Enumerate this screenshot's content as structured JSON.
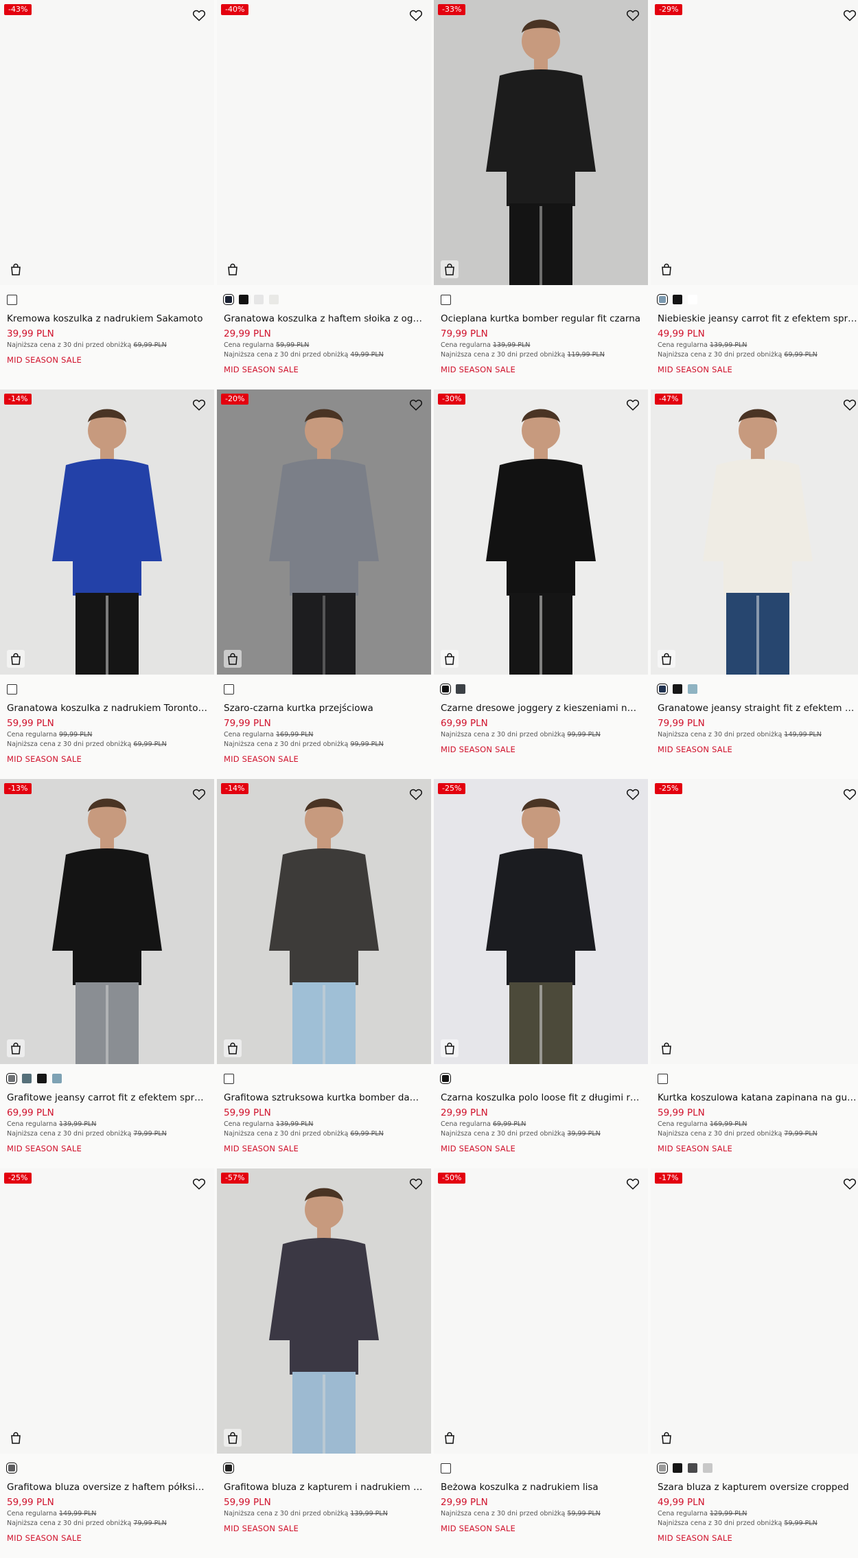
{
  "products": [
    {
      "badge": "-43%",
      "photo": false,
      "title": "Kremowa koszulka z nadrukiem Sakamoto",
      "price": "39,99 PLN",
      "regular": null,
      "lowest_label": "Najniższa cena z 30 dni przed obniżką",
      "lowest": "69,99 PLN",
      "sale": "MID SEASON SALE",
      "swatches": [
        {
          "c": "#ffffff",
          "type": "empty"
        }
      ],
      "bg": "#f7f7f6",
      "figure": null
    },
    {
      "badge": "-40%",
      "photo": false,
      "title": "Granatowa koszulka z haftem słoika z ogórkiem",
      "price": "29,99 PLN",
      "regular_label": "Cena regularna",
      "regular": "59,99 PLN",
      "lowest_label": "Najniższa cena z 30 dni przed obniżką",
      "lowest": "49,99 PLN",
      "sale": "MID SEASON SALE",
      "swatches": [
        {
          "c": "#1b2233",
          "type": "sel"
        },
        {
          "c": "#111111"
        },
        {
          "c": "#e6e6e6"
        },
        {
          "c": "#e9e9e6"
        }
      ],
      "bg": "#f7f7f6",
      "figure": null
    },
    {
      "badge": "-33%",
      "photo": true,
      "title": "Ocieplana kurtka bomber regular fit czarna",
      "price": "79,99 PLN",
      "regular_label": "Cena regularna",
      "regular": "139,99 PLN",
      "lowest_label": "Najniższa cena z 30 dni przed obniżką",
      "lowest": "119,99 PLN",
      "sale": "MID SEASON SALE",
      "swatches": [
        {
          "c": "#ffffff",
          "type": "empty"
        }
      ],
      "bg": "#c9c9c8",
      "figure": {
        "top": "#1c1c1c",
        "bottom": "#141414"
      }
    },
    {
      "badge": "-29%",
      "photo": false,
      "title": "Niebieskie jeansy carrot fit z efektem sprania",
      "price": "49,99 PLN",
      "regular_label": "Cena regularna",
      "regular": "139,99 PLN",
      "lowest_label": "Najniższa cena z 30 dni przed obniżką",
      "lowest": "69,99 PLN",
      "sale": "MID SEASON SALE",
      "swatches": [
        {
          "c": "#7c9ab0",
          "type": "sel"
        },
        {
          "c": "#141414"
        },
        {
          "c": "#ffffff"
        }
      ],
      "bg": "#f7f7f6",
      "figure": null
    },
    {
      "badge": "-14%",
      "photo": true,
      "title": "Granatowa koszulka z nadrukiem Toronto Maple Leafs",
      "price": "59,99 PLN",
      "regular_label": "Cena regularna",
      "regular": "99,99 PLN",
      "lowest_label": "Najniższa cena z 30 dni przed obniżką",
      "lowest": "69,99 PLN",
      "sale": "MID SEASON SALE",
      "swatches": [
        {
          "c": "#ffffff",
          "type": "empty"
        }
      ],
      "bg": "#e4e4e3",
      "figure": {
        "top": "#2341a8",
        "bottom": "#151515"
      }
    },
    {
      "badge": "-20%",
      "photo": true,
      "title": "Szaro-czarna kurtka przejściowa",
      "price": "79,99 PLN",
      "regular_label": "Cena regularna",
      "regular": "169,99 PLN",
      "lowest_label": "Najniższa cena z 30 dni przed obniżką",
      "lowest": "99,99 PLN",
      "sale": "MID SEASON SALE",
      "swatches": [
        {
          "c": "#ffffff",
          "type": "empty"
        }
      ],
      "bg": "#8d8d8d",
      "figure": {
        "top": "#7b7f88",
        "bottom": "#1d1d1f"
      }
    },
    {
      "badge": "-30%",
      "photo": true,
      "title": "Czarne dresowe joggery z kieszeniami na zamek",
      "price": "69,99 PLN",
      "regular": null,
      "lowest_label": "Najniższa cena z 30 dni przed obniżką",
      "lowest": "99,99 PLN",
      "sale": "MID SEASON SALE",
      "swatches": [
        {
          "c": "#111111",
          "type": "sel"
        },
        {
          "c": "#3c4146"
        }
      ],
      "bg": "#ededec",
      "figure": {
        "top": "#121212",
        "bottom": "#151515"
      }
    },
    {
      "badge": "-47%",
      "photo": true,
      "title": "Granatowe jeansy straight fit z efektem sprania",
      "price": "79,99 PLN",
      "regular": null,
      "lowest_label": "Najniższa cena z 30 dni przed obniżką",
      "lowest": "149,99 PLN",
      "sale": "MID SEASON SALE",
      "swatches": [
        {
          "c": "#20324f",
          "type": "sel"
        },
        {
          "c": "#171717"
        },
        {
          "c": "#8fb3c2"
        }
      ],
      "bg": "#ececeb",
      "figure": {
        "top": "#efece4",
        "bottom": "#27466f"
      }
    },
    {
      "badge": "-13%",
      "photo": true,
      "title": "Grafitowe jeansy carrot fit z efektem sprania",
      "price": "69,99 PLN",
      "regular_label": "Cena regularna",
      "regular": "139,99 PLN",
      "lowest_label": "Najniższa cena z 30 dni przed obniżką",
      "lowest": "79,99 PLN",
      "sale": "MID SEASON SALE",
      "swatches": [
        {
          "c": "#6f7275",
          "type": "sel"
        },
        {
          "c": "#56707a"
        },
        {
          "c": "#161616"
        },
        {
          "c": "#7ea2b4"
        }
      ],
      "bg": "#d8d8d7",
      "figure": {
        "top": "#141414",
        "bottom": "#8a8e93"
      }
    },
    {
      "badge": "-14%",
      "photo": true,
      "title": "Grafitowa sztruksowa kurtka bomber dad fit",
      "price": "59,99 PLN",
      "regular_label": "Cena regularna",
      "regular": "139,99 PLN",
      "lowest_label": "Najniższa cena z 30 dni przed obniżką",
      "lowest": "69,99 PLN",
      "sale": "MID SEASON SALE",
      "swatches": [
        {
          "c": "#ffffff",
          "type": "empty"
        }
      ],
      "bg": "#d6d6d4",
      "figure": {
        "top": "#3d3b39",
        "bottom": "#9fbfd6"
      }
    },
    {
      "badge": "-25%",
      "photo": true,
      "title": "Czarna koszulka polo loose fit z długimi rękawami",
      "price": "29,99 PLN",
      "regular_label": "Cena regularna",
      "regular": "69,99 PLN",
      "lowest_label": "Najniższa cena z 30 dni przed obniżką",
      "lowest": "39,99 PLN",
      "sale": "MID SEASON SALE",
      "swatches": [
        {
          "c": "#141414",
          "type": "sel"
        }
      ],
      "bg": "#e6e6ea",
      "figure": {
        "top": "#1b1c20",
        "bottom": "#4c4a3a"
      }
    },
    {
      "badge": "-25%",
      "photo": false,
      "title": "Kurtka koszulowa katana zapinana na guziki",
      "price": "59,99 PLN",
      "regular_label": "Cena regularna",
      "regular": "169,99 PLN",
      "lowest_label": "Najniższa cena z 30 dni przed obniżką",
      "lowest": "79,99 PLN",
      "sale": "MID SEASON SALE",
      "swatches": [
        {
          "c": "#ffffff",
          "type": "empty"
        }
      ],
      "bg": "#f7f7f6",
      "figure": null
    },
    {
      "badge": "-25%",
      "photo": false,
      "title": "Grafitowa bluza oversize z haftem półksiężyca",
      "price": "59,99 PLN",
      "regular_label": "Cena regularna",
      "regular": "149,99 PLN",
      "lowest_label": "Najniższa cena z 30 dni przed obniżką",
      "lowest": "79,99 PLN",
      "sale": "MID SEASON SALE",
      "swatches": [
        {
          "c": "#5d5d5f",
          "type": "sel"
        }
      ],
      "bg": "#f7f7f6",
      "figure": null
    },
    {
      "badge": "-57%",
      "photo": true,
      "title": "Grafitowa bluza z kapturem i nadrukiem w stylu graffiti",
      "price": "59,99 PLN",
      "regular": null,
      "lowest_label": "Najniższa cena z 30 dni przed obniżką",
      "lowest": "139,99 PLN",
      "sale": "MID SEASON SALE",
      "swatches": [
        {
          "c": "#222222",
          "type": "sel"
        }
      ],
      "bg": "#d7d7d5",
      "figure": {
        "top": "#3b3844",
        "bottom": "#9dbad1"
      }
    },
    {
      "badge": "-50%",
      "photo": false,
      "title": "Beżowa koszulka z nadrukiem lisa",
      "price": "29,99 PLN",
      "regular": null,
      "lowest_label": "Najniższa cena z 30 dni przed obniżką",
      "lowest": "59,99 PLN",
      "sale": "MID SEASON SALE",
      "swatches": [
        {
          "c": "#ffffff",
          "type": "empty"
        }
      ],
      "bg": "#f7f7f6",
      "figure": null
    },
    {
      "badge": "-17%",
      "photo": false,
      "title": "Szara bluza z kapturem oversize cropped",
      "price": "49,99 PLN",
      "regular_label": "Cena regularna",
      "regular": "129,99 PLN",
      "lowest_label": "Najniższa cena z 30 dni przed obniżką",
      "lowest": "59,99 PLN",
      "sale": "MID SEASON SALE",
      "swatches": [
        {
          "c": "#9a9a9a",
          "type": "sel"
        },
        {
          "c": "#151515"
        },
        {
          "c": "#4a4a4c"
        },
        {
          "c": "#c8c8c8"
        }
      ],
      "bg": "#f7f7f6",
      "figure": null
    }
  ],
  "icons": {
    "favorite": "heart-icon",
    "cart": "shopping-bag-icon"
  }
}
